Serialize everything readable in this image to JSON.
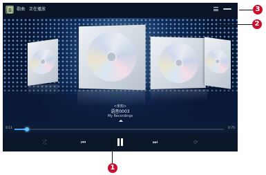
{
  "header": {
    "tabs": [
      "歌曲",
      "正在播放"
    ],
    "icons": [
      "music-app-icon",
      "list-icon",
      "more-icon"
    ]
  },
  "now_playing": {
    "subtitle": "<未知>",
    "title": "语音0003",
    "artist": "My Recordings"
  },
  "progress": {
    "elapsed": "0:11",
    "total": "0:75",
    "fraction": 0.06,
    "accent": "#3fa9f5"
  },
  "controls": {
    "icons": [
      "shuffle-icon",
      "previous-icon",
      "pause-icon",
      "next-icon",
      "repeat-icon"
    ],
    "symbols": {
      "previous": "⏮",
      "next": "⏭",
      "shuffle": "⤮",
      "repeat": "⟳"
    }
  },
  "callouts": [
    "1",
    "2",
    "3"
  ],
  "callout_color": "#c8102e"
}
